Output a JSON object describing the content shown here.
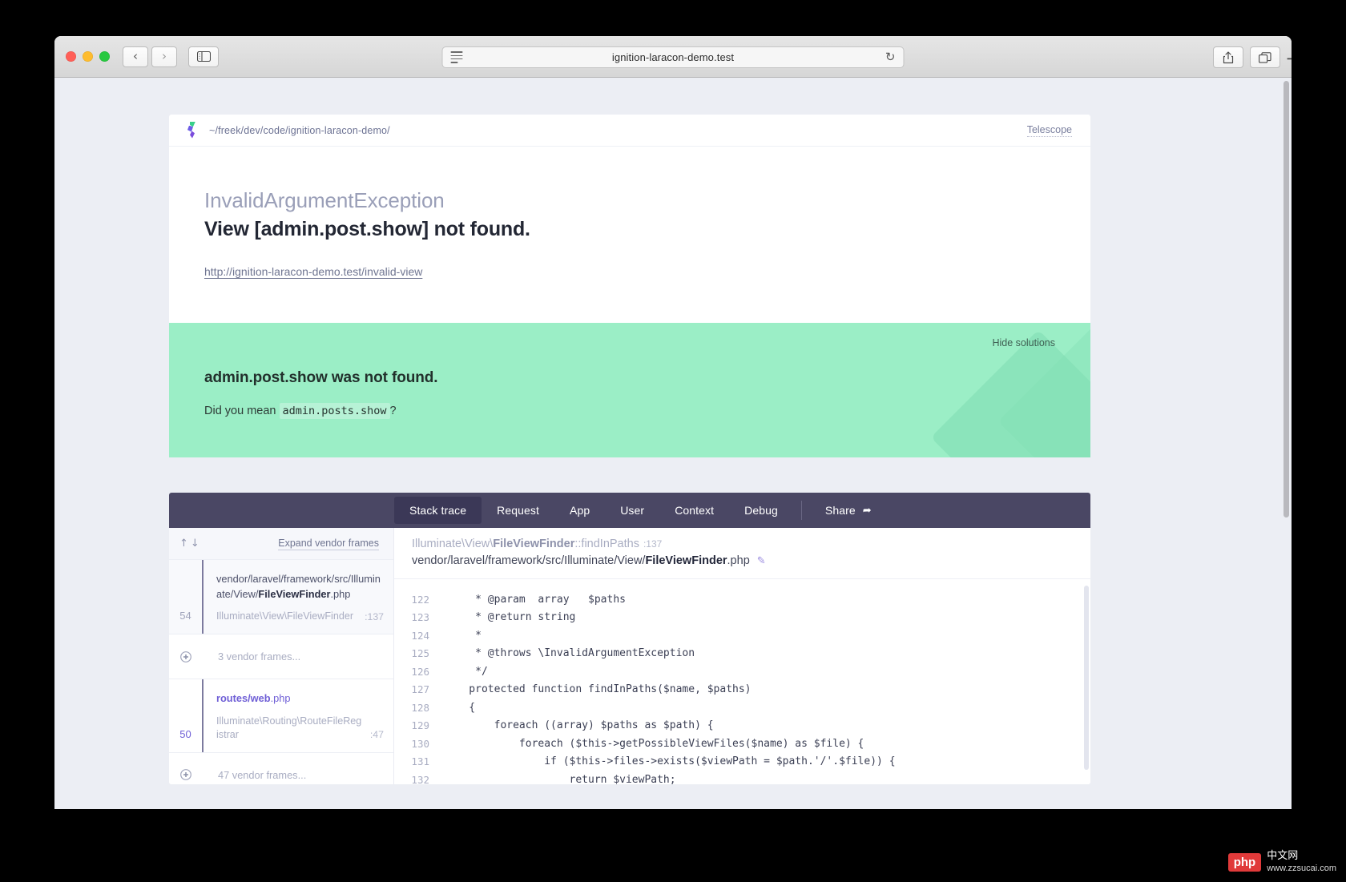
{
  "browser": {
    "url": "ignition-laracon-demo.test",
    "back_icon": "chevron-left-icon",
    "forward_icon": "chevron-right-icon",
    "sidebar_icon": "sidebar-toggle-icon",
    "reader_icon": "reader-view-icon",
    "reload_icon": "↻",
    "share_icon": "share-icon",
    "tabs_icon": "tab-overview-icon",
    "new_tab_label": "+"
  },
  "ignition": {
    "project_path": "~/freek/dev/code/ignition-laracon-demo/",
    "telescope_label": "Telescope",
    "exception": {
      "class": "InvalidArgumentException",
      "message": "View [admin.post.show] not found.",
      "url": "http://ignition-laracon-demo.test/invalid-view"
    },
    "solution": {
      "hide_label": "Hide solutions",
      "title": "admin.post.show was not found.",
      "body_prefix": "Did you mean",
      "suggestion": "admin.posts.show",
      "body_suffix": "?"
    },
    "tabs": [
      {
        "label": "Stack trace",
        "active": true
      },
      {
        "label": "Request",
        "active": false
      },
      {
        "label": "App",
        "active": false
      },
      {
        "label": "User",
        "active": false
      },
      {
        "label": "Context",
        "active": false
      },
      {
        "label": "Debug",
        "active": false
      }
    ],
    "share_label": "Share",
    "share_arrow": "➦",
    "frames_header": {
      "up_arrow": "↑",
      "down_arrow": "↓",
      "expand_label": "Expand vendor frames"
    },
    "frames": [
      {
        "type": "frame",
        "number": "54",
        "file_prefix": "vendor/laravel/framework/src/Illuminate/View/",
        "file_bold": "FileViewFinder",
        "file_suffix": ".php",
        "class": "Illuminate\\View\\FileViewFinder",
        "line": ":137",
        "selected": true
      },
      {
        "type": "collapsed",
        "label": "3 vendor frames..."
      },
      {
        "type": "frame",
        "number": "50",
        "file_prefix": "routes/",
        "file_bold": "web",
        "file_suffix": ".php",
        "class": "Illuminate\\Routing\\RouteFileRegistrar",
        "line": ":47",
        "selected": false,
        "accent": true
      },
      {
        "type": "collapsed",
        "label": "47 vendor frames..."
      }
    ],
    "code": {
      "method_prefix": "Illuminate\\View\\",
      "method_bold": "FileViewFinder",
      "method_suffix": "::findInPaths",
      "method_line": ":137",
      "path_prefix": "vendor/laravel/framework/src/Illuminate/View/",
      "path_bold": "FileViewFinder",
      "path_suffix": ".php",
      "edit_icon": "✎",
      "lines": [
        {
          "n": "122",
          "text": "     * @param  array   $paths"
        },
        {
          "n": "123",
          "text": "     * @return string"
        },
        {
          "n": "124",
          "text": "     *"
        },
        {
          "n": "125",
          "text": "     * @throws \\InvalidArgumentException"
        },
        {
          "n": "126",
          "text": "     */"
        },
        {
          "n": "127",
          "text": "    protected function findInPaths($name, $paths)"
        },
        {
          "n": "128",
          "text": "    {"
        },
        {
          "n": "129",
          "text": "        foreach ((array) $paths as $path) {"
        },
        {
          "n": "130",
          "text": "            foreach ($this->getPossibleViewFiles($name) as $file) {"
        },
        {
          "n": "131",
          "text": "                if ($this->files->exists($viewPath = $path.'/'.$file)) {"
        },
        {
          "n": "132",
          "text": "                    return $viewPath;"
        }
      ]
    }
  },
  "watermark": {
    "badge": "php",
    "line1": "中文网",
    "line2": "www.zzsucai.com"
  },
  "colors": {
    "accent_purple": "#6f5fd6",
    "tab_bar": "#4a4764",
    "solution_green": "#9beec6",
    "page_bg": "#eceef4"
  }
}
